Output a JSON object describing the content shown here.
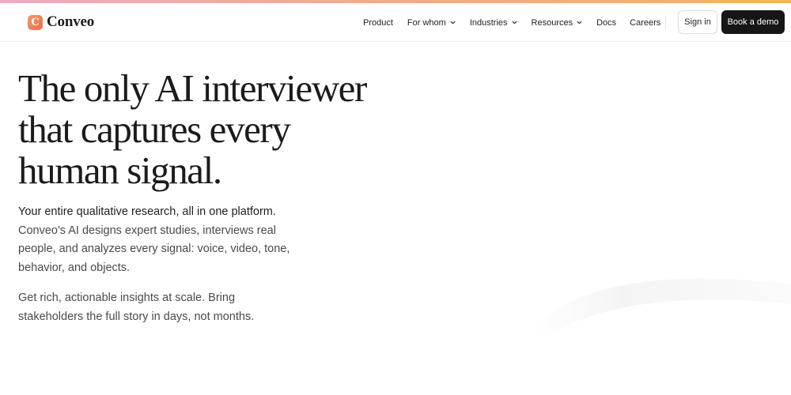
{
  "brand": {
    "logo_letter": "C",
    "name": "Conveo",
    "accent_color": "#ee6a4a"
  },
  "nav": {
    "links": [
      {
        "label": "Product",
        "has_dropdown": false
      },
      {
        "label": "For whom",
        "has_dropdown": true
      },
      {
        "label": "Industries",
        "has_dropdown": true
      },
      {
        "label": "Resources",
        "has_dropdown": true
      },
      {
        "label": "Docs",
        "has_dropdown": false
      },
      {
        "label": "Careers",
        "has_dropdown": false
      }
    ],
    "signin_label": "Sign in",
    "demo_label": "Book a demo"
  },
  "hero": {
    "title_lines": [
      "The only AI interviewer",
      "that captures every",
      "human signal."
    ],
    "lead": "Your entire qualitative research, all in one platform.",
    "description": "Conveo's AI designs expert studies, interviews real people, and analyzes every signal: voice, video, tone, behavior, and objects.",
    "secondary": "Get rich, actionable insights at scale. Bring stakeholders the full story in days, not months."
  },
  "colors": {
    "top_accent_gradient": [
      "#f3a9c4",
      "#f5a98a",
      "#f7b25c"
    ],
    "primary_button": "#161616",
    "text": "#1b1b1b"
  }
}
